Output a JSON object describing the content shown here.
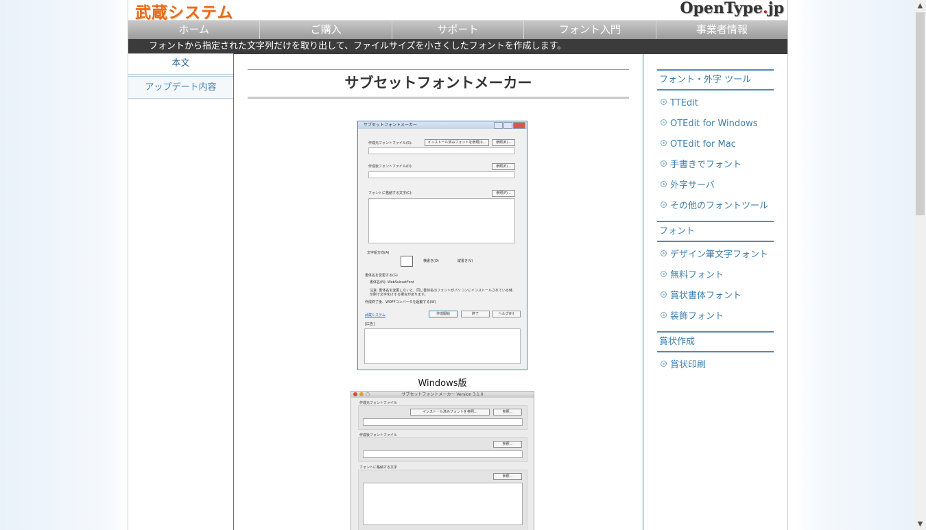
{
  "header": {
    "logo_left": "武蔵システム",
    "logo_right_a": "OpenType",
    "logo_right_dot": ".",
    "logo_right_b": "jp"
  },
  "nav": [
    "ホーム",
    "ご購入",
    "サポート",
    "フォント入門",
    "事業者情報"
  ],
  "tagline": "フォントから指定された文字列だけを取り出して、ファイルサイズを小さくしたフォントを作成します。",
  "left_tabs": {
    "active": "本文",
    "inactive": "アップデート内容"
  },
  "main": {
    "title": "サブセットフォントメーカー",
    "caption_windows": "Windows版"
  },
  "win_shot": {
    "title": "サブセットフォントメーカー",
    "source_label": "作成元フォントファイル(S):",
    "installed_btn": "インストール済みフォントを参照(I)...",
    "browse1": "参照(B)...",
    "dest_label": "作成後フォントファイル(D):",
    "browse2": "参照(E)...",
    "chars_label": "フォントに格納する文字(C):",
    "browse3": "参照(F)...",
    "direction_label": "文字組方向(A)",
    "horizontal": "横書き(O)",
    "vertical": "縦書き(V)",
    "rename_label": "書体名を変更する(G)",
    "font_name_label": "書体名(N): WebSubsetFont",
    "note": "注意: 書体名を変更しないと、同じ書体名のフォントがパソコンにインストールされている時、印刷で文字化けする場合があります。",
    "woff_label": "作成終了後、WOFFコンバータを起動する(W)",
    "link": "武蔵システム",
    "create_btn": "作成開始",
    "exit_btn": "終了",
    "help_btn": "ヘルプ(H)",
    "ad_label": "[広告]"
  },
  "mac_shot": {
    "title": "サブセットフォントメーカー Version 3.1.0",
    "source_label": "作成元フォントファイル",
    "installed_btn": "インストール済みフォントを参照...",
    "browse1": "参照...",
    "dest_label": "作成後フォントファイル",
    "browse2": "参照...",
    "chars_label": "フォントに格納する文字",
    "browse3": "参照..."
  },
  "sidebar": {
    "sections": [
      {
        "title": "フォント・外字 ツール",
        "links": [
          "TTEdit",
          "OTEdit for Windows",
          "OTEdit for Mac",
          "手書きでフォント",
          "外字サーバ",
          "その他のフォントツール"
        ]
      },
      {
        "title": "フォント",
        "links": [
          "デザイン筆文字フォント",
          "無料フォント",
          "賞状書体フォント",
          "装飾フォント"
        ]
      },
      {
        "title": "賞状作成",
        "links": [
          "賞状印刷"
        ]
      }
    ]
  },
  "colors": {
    "logo_orange": "#e86a1a",
    "link_blue": "#3d7fb0",
    "tagline_bg": "#3b3b3b"
  }
}
